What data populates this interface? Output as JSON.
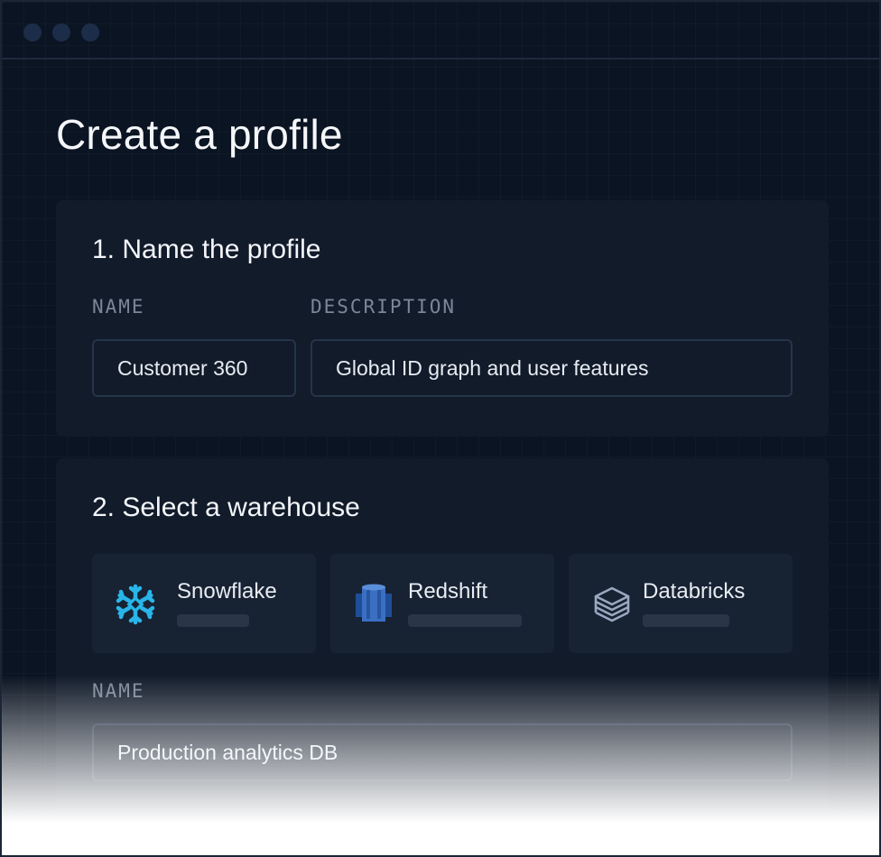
{
  "window": {
    "controls": [
      "close-dot",
      "minimize-dot",
      "maximize-dot"
    ]
  },
  "page": {
    "title": "Create a profile"
  },
  "section1": {
    "title": "1. Name the profile",
    "name_label": "NAME",
    "name_value": "Customer 360",
    "description_label": "DESCRIPTION",
    "description_value": "Global ID graph and user features"
  },
  "section2": {
    "title": "2. Select a warehouse",
    "warehouses": [
      {
        "name": "Snowflake",
        "icon": "snowflake-icon",
        "color": "#29b5e8"
      },
      {
        "name": "Redshift",
        "icon": "redshift-icon",
        "color": "#3b6fc4"
      },
      {
        "name": "Databricks",
        "icon": "databricks-icon",
        "color": "#9aa8c0"
      }
    ],
    "name_label": "NAME",
    "name_value": "Production analytics DB"
  },
  "colors": {
    "background": "#0b1422",
    "card": "#111b2a",
    "tile": "#172233",
    "input_border": "#25344a",
    "label": "#7b8798",
    "text": "#e8ecf2"
  }
}
